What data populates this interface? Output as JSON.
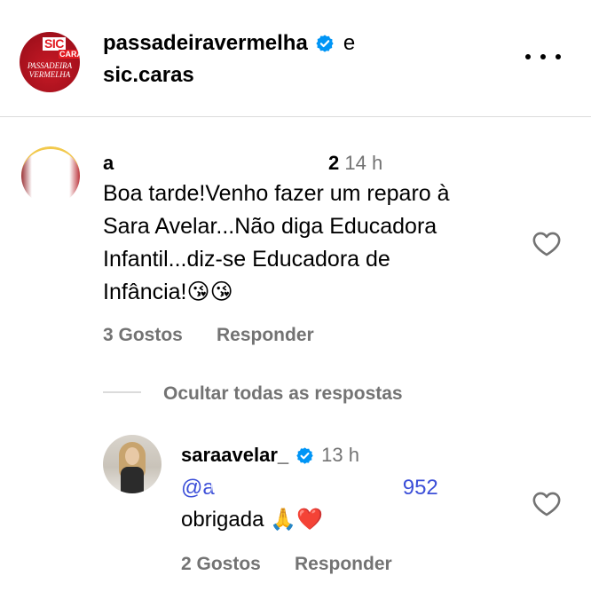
{
  "post_header": {
    "logo": {
      "sic_text": "SIC",
      "caras_text": "CARAS",
      "brand_line1": "PASSADEIRA",
      "brand_line2": "VERMELHA"
    },
    "author_primary": "passadeiravermelha",
    "conjunction": "e",
    "author_secondary": "sic.caras",
    "more_icon": "more-horizontal-icon"
  },
  "comment": {
    "username": "a",
    "likes_count_inline": "2",
    "time": "14 h",
    "text_line1": "Boa tarde!Venho fazer um reparo à",
    "text_line2": "Sara Avelar...Não diga Educadora",
    "text_line3": "Infantil...diz-se Educadora de",
    "text_line4": "Infância!",
    "emojis": "😘😘",
    "likes_label": "3 Gostos",
    "reply_label": "Responder",
    "like_icon": "heart-icon"
  },
  "replies_toggle": {
    "label": "Ocultar todas as respostas"
  },
  "reply": {
    "username": "saraavelar_",
    "time": "13 h",
    "mention": "@a",
    "mention_tail": "952",
    "text": "obrigada",
    "emojis": "🙏❤️",
    "likes_label": "2 Gostos",
    "reply_label": "Responder",
    "like_icon": "heart-icon"
  },
  "colors": {
    "verified_blue": "#0095f6",
    "secondary_text": "#737373",
    "mention_blue": "#3c4fd8",
    "brand_red": "#e11b22"
  }
}
